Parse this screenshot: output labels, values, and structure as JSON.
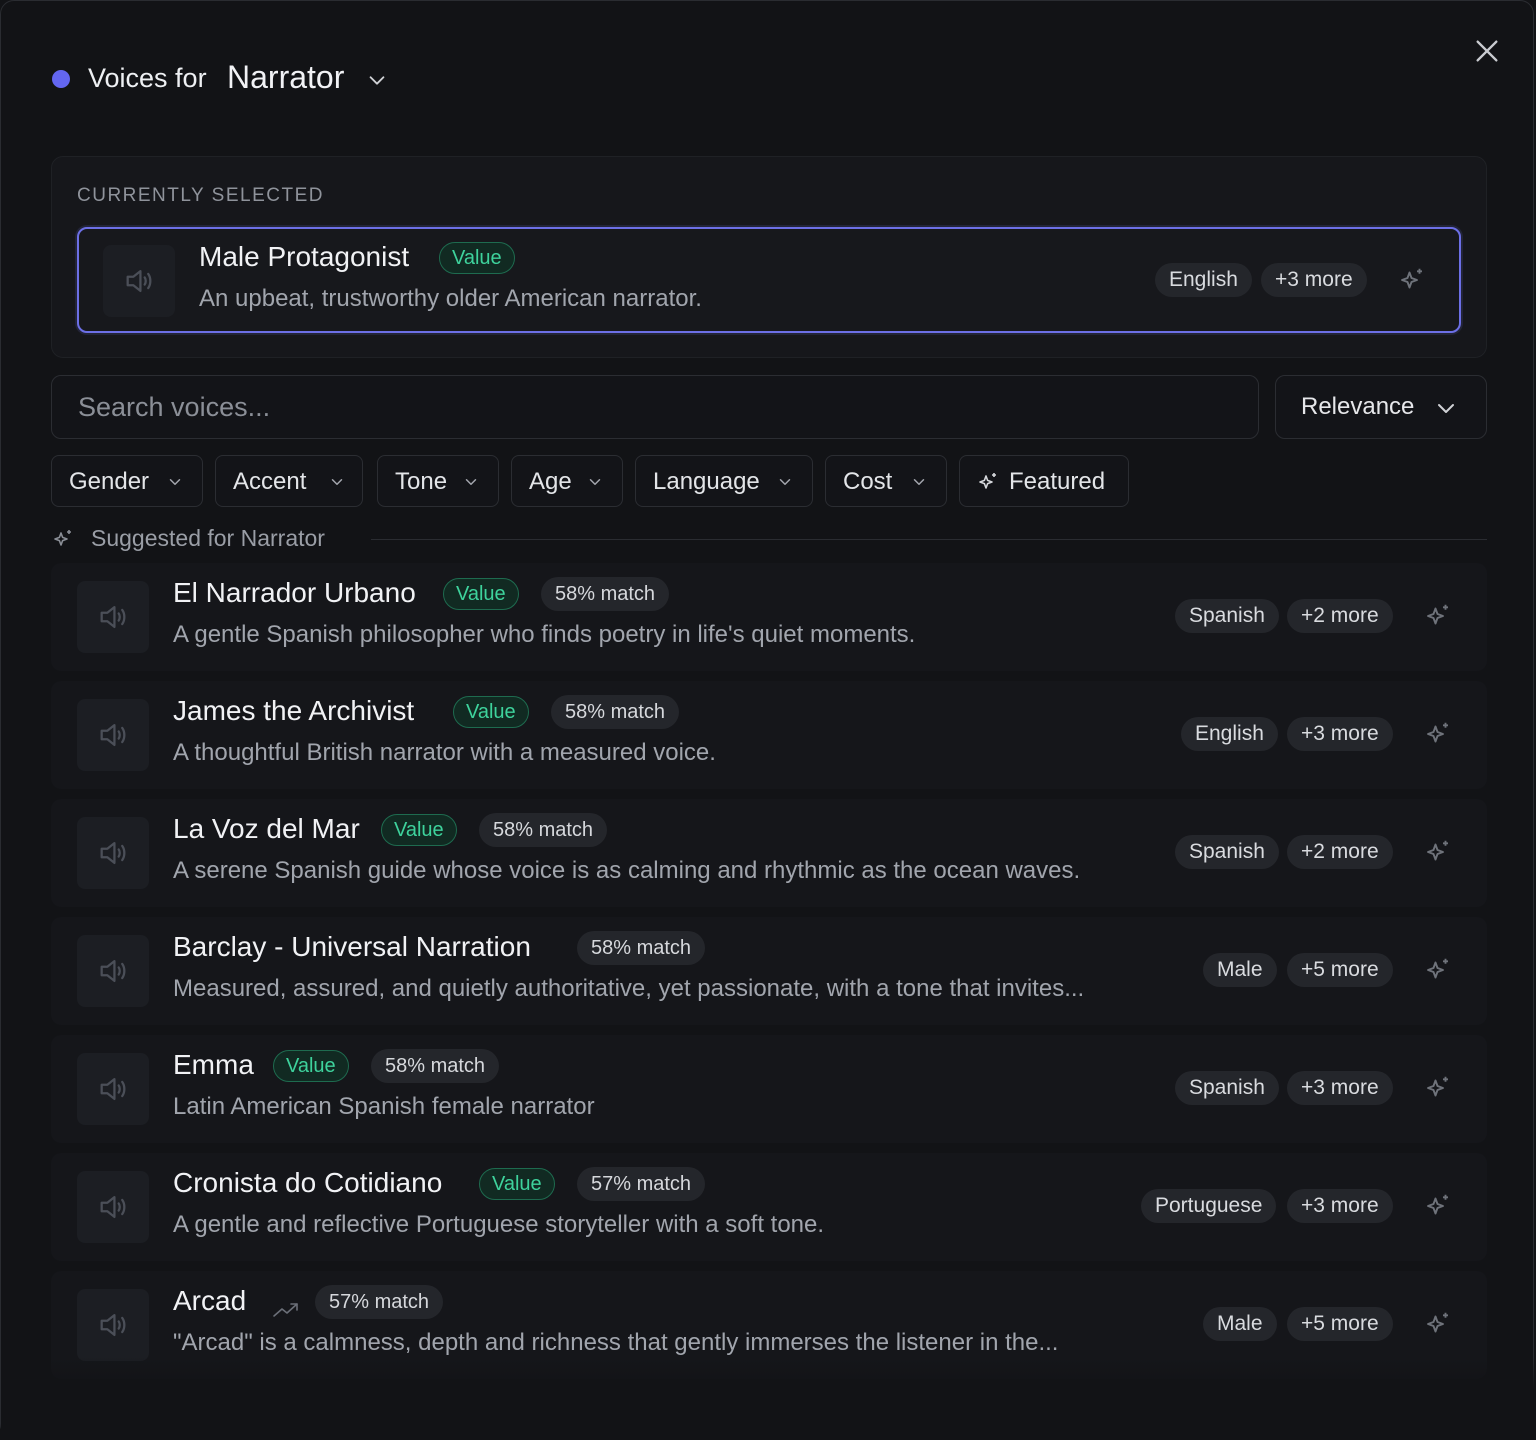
{
  "header": {
    "title_prefix": "Voices for",
    "role_name": "Narrator",
    "role_color": "#6366f1"
  },
  "current": {
    "section_label": "CURRENTLY SELECTED",
    "voice": {
      "name": "Male Protagonist",
      "badge": "Value",
      "description": "An upbeat, trustworthy older American narrator.",
      "tag": "English",
      "more": "+3 more"
    }
  },
  "search": {
    "placeholder": "Search voices..."
  },
  "sort": {
    "label": "Relevance"
  },
  "filters": [
    "Gender",
    "Accent",
    "Tone",
    "Age",
    "Language",
    "Cost"
  ],
  "featured_label": "Featured",
  "suggested_label": "Suggested for Narrator",
  "voices": [
    {
      "name": "El Narrador Urbano",
      "badge": "Value",
      "match": "58% match",
      "description": "A gentle Spanish philosopher who finds poetry in life's quiet moments.",
      "tag": "Spanish",
      "more": "+2 more"
    },
    {
      "name": "James the Archivist",
      "badge": "Value",
      "match": "58% match",
      "description": "A thoughtful British narrator with a measured voice.",
      "tag": "English",
      "more": "+3 more"
    },
    {
      "name": "La Voz del Mar",
      "badge": "Value",
      "match": "58% match",
      "description": "A serene Spanish guide whose voice is as calming and rhythmic as the ocean waves.",
      "tag": "Spanish",
      "more": "+2 more"
    },
    {
      "name": "Barclay - Universal Narration",
      "badge": "",
      "match": "58% match",
      "description": "Measured, assured, and quietly authoritative, yet passionate, with a tone that invites...",
      "tag": "Male",
      "more": "+5 more"
    },
    {
      "name": "Emma",
      "badge": "Value",
      "match": "58% match",
      "description": "Latin American Spanish female narrator",
      "tag": "Spanish",
      "more": "+3 more"
    },
    {
      "name": "Cronista do Cotidiano",
      "badge": "Value",
      "match": "57% match",
      "description": "A gentle and reflective Portuguese storyteller with a soft tone.",
      "tag": "Portuguese",
      "more": "+3 more"
    },
    {
      "name": "Arcad",
      "badge": "",
      "trending_icon": "trending-up-icon",
      "match": "57% match",
      "description": "\"Arcad\" is a calmness, depth and richness that gently immerses the listener in the...",
      "tag": "Male",
      "more": "+5 more"
    }
  ]
}
